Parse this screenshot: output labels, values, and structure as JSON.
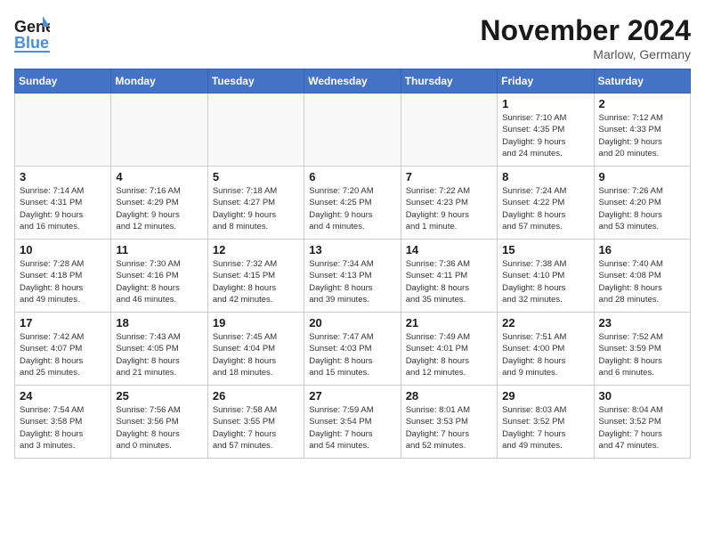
{
  "header": {
    "logo_general": "General",
    "logo_blue": "Blue",
    "month_title": "November 2024",
    "location": "Marlow, Germany"
  },
  "days_of_week": [
    "Sunday",
    "Monday",
    "Tuesday",
    "Wednesday",
    "Thursday",
    "Friday",
    "Saturday"
  ],
  "weeks": [
    [
      {
        "day": "",
        "info": ""
      },
      {
        "day": "",
        "info": ""
      },
      {
        "day": "",
        "info": ""
      },
      {
        "day": "",
        "info": ""
      },
      {
        "day": "",
        "info": ""
      },
      {
        "day": "1",
        "info": "Sunrise: 7:10 AM\nSunset: 4:35 PM\nDaylight: 9 hours\nand 24 minutes."
      },
      {
        "day": "2",
        "info": "Sunrise: 7:12 AM\nSunset: 4:33 PM\nDaylight: 9 hours\nand 20 minutes."
      }
    ],
    [
      {
        "day": "3",
        "info": "Sunrise: 7:14 AM\nSunset: 4:31 PM\nDaylight: 9 hours\nand 16 minutes."
      },
      {
        "day": "4",
        "info": "Sunrise: 7:16 AM\nSunset: 4:29 PM\nDaylight: 9 hours\nand 12 minutes."
      },
      {
        "day": "5",
        "info": "Sunrise: 7:18 AM\nSunset: 4:27 PM\nDaylight: 9 hours\nand 8 minutes."
      },
      {
        "day": "6",
        "info": "Sunrise: 7:20 AM\nSunset: 4:25 PM\nDaylight: 9 hours\nand 4 minutes."
      },
      {
        "day": "7",
        "info": "Sunrise: 7:22 AM\nSunset: 4:23 PM\nDaylight: 9 hours\nand 1 minute."
      },
      {
        "day": "8",
        "info": "Sunrise: 7:24 AM\nSunset: 4:22 PM\nDaylight: 8 hours\nand 57 minutes."
      },
      {
        "day": "9",
        "info": "Sunrise: 7:26 AM\nSunset: 4:20 PM\nDaylight: 8 hours\nand 53 minutes."
      }
    ],
    [
      {
        "day": "10",
        "info": "Sunrise: 7:28 AM\nSunset: 4:18 PM\nDaylight: 8 hours\nand 49 minutes."
      },
      {
        "day": "11",
        "info": "Sunrise: 7:30 AM\nSunset: 4:16 PM\nDaylight: 8 hours\nand 46 minutes."
      },
      {
        "day": "12",
        "info": "Sunrise: 7:32 AM\nSunset: 4:15 PM\nDaylight: 8 hours\nand 42 minutes."
      },
      {
        "day": "13",
        "info": "Sunrise: 7:34 AM\nSunset: 4:13 PM\nDaylight: 8 hours\nand 39 minutes."
      },
      {
        "day": "14",
        "info": "Sunrise: 7:36 AM\nSunset: 4:11 PM\nDaylight: 8 hours\nand 35 minutes."
      },
      {
        "day": "15",
        "info": "Sunrise: 7:38 AM\nSunset: 4:10 PM\nDaylight: 8 hours\nand 32 minutes."
      },
      {
        "day": "16",
        "info": "Sunrise: 7:40 AM\nSunset: 4:08 PM\nDaylight: 8 hours\nand 28 minutes."
      }
    ],
    [
      {
        "day": "17",
        "info": "Sunrise: 7:42 AM\nSunset: 4:07 PM\nDaylight: 8 hours\nand 25 minutes."
      },
      {
        "day": "18",
        "info": "Sunrise: 7:43 AM\nSunset: 4:05 PM\nDaylight: 8 hours\nand 21 minutes."
      },
      {
        "day": "19",
        "info": "Sunrise: 7:45 AM\nSunset: 4:04 PM\nDaylight: 8 hours\nand 18 minutes."
      },
      {
        "day": "20",
        "info": "Sunrise: 7:47 AM\nSunset: 4:03 PM\nDaylight: 8 hours\nand 15 minutes."
      },
      {
        "day": "21",
        "info": "Sunrise: 7:49 AM\nSunset: 4:01 PM\nDaylight: 8 hours\nand 12 minutes."
      },
      {
        "day": "22",
        "info": "Sunrise: 7:51 AM\nSunset: 4:00 PM\nDaylight: 8 hours\nand 9 minutes."
      },
      {
        "day": "23",
        "info": "Sunrise: 7:52 AM\nSunset: 3:59 PM\nDaylight: 8 hours\nand 6 minutes."
      }
    ],
    [
      {
        "day": "24",
        "info": "Sunrise: 7:54 AM\nSunset: 3:58 PM\nDaylight: 8 hours\nand 3 minutes."
      },
      {
        "day": "25",
        "info": "Sunrise: 7:56 AM\nSunset: 3:56 PM\nDaylight: 8 hours\nand 0 minutes."
      },
      {
        "day": "26",
        "info": "Sunrise: 7:58 AM\nSunset: 3:55 PM\nDaylight: 7 hours\nand 57 minutes."
      },
      {
        "day": "27",
        "info": "Sunrise: 7:59 AM\nSunset: 3:54 PM\nDaylight: 7 hours\nand 54 minutes."
      },
      {
        "day": "28",
        "info": "Sunrise: 8:01 AM\nSunset: 3:53 PM\nDaylight: 7 hours\nand 52 minutes."
      },
      {
        "day": "29",
        "info": "Sunrise: 8:03 AM\nSunset: 3:52 PM\nDaylight: 7 hours\nand 49 minutes."
      },
      {
        "day": "30",
        "info": "Sunrise: 8:04 AM\nSunset: 3:52 PM\nDaylight: 7 hours\nand 47 minutes."
      }
    ]
  ]
}
